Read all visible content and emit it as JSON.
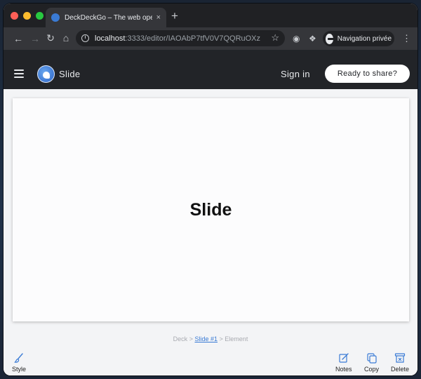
{
  "browser": {
    "tab_title": "DeckDeckGo – The web open",
    "tab_close": "×",
    "new_tab": "+",
    "url_host": "localhost",
    "url_rest": ":3333/editor/IAOAbP7tfV0V7QQRuOXz",
    "profile_label": "Navigation privée"
  },
  "app": {
    "title": "Slide",
    "sign_in": "Sign in",
    "share_button": "Ready to share?"
  },
  "slide": {
    "title": "Slide"
  },
  "breadcrumb": {
    "deck": "Deck",
    "sep1": ">",
    "slide": "Slide #1",
    "sep2": ">",
    "element": "Element"
  },
  "actions": {
    "style": "Style",
    "notes": "Notes",
    "copy": "Copy",
    "delete": "Delete"
  }
}
